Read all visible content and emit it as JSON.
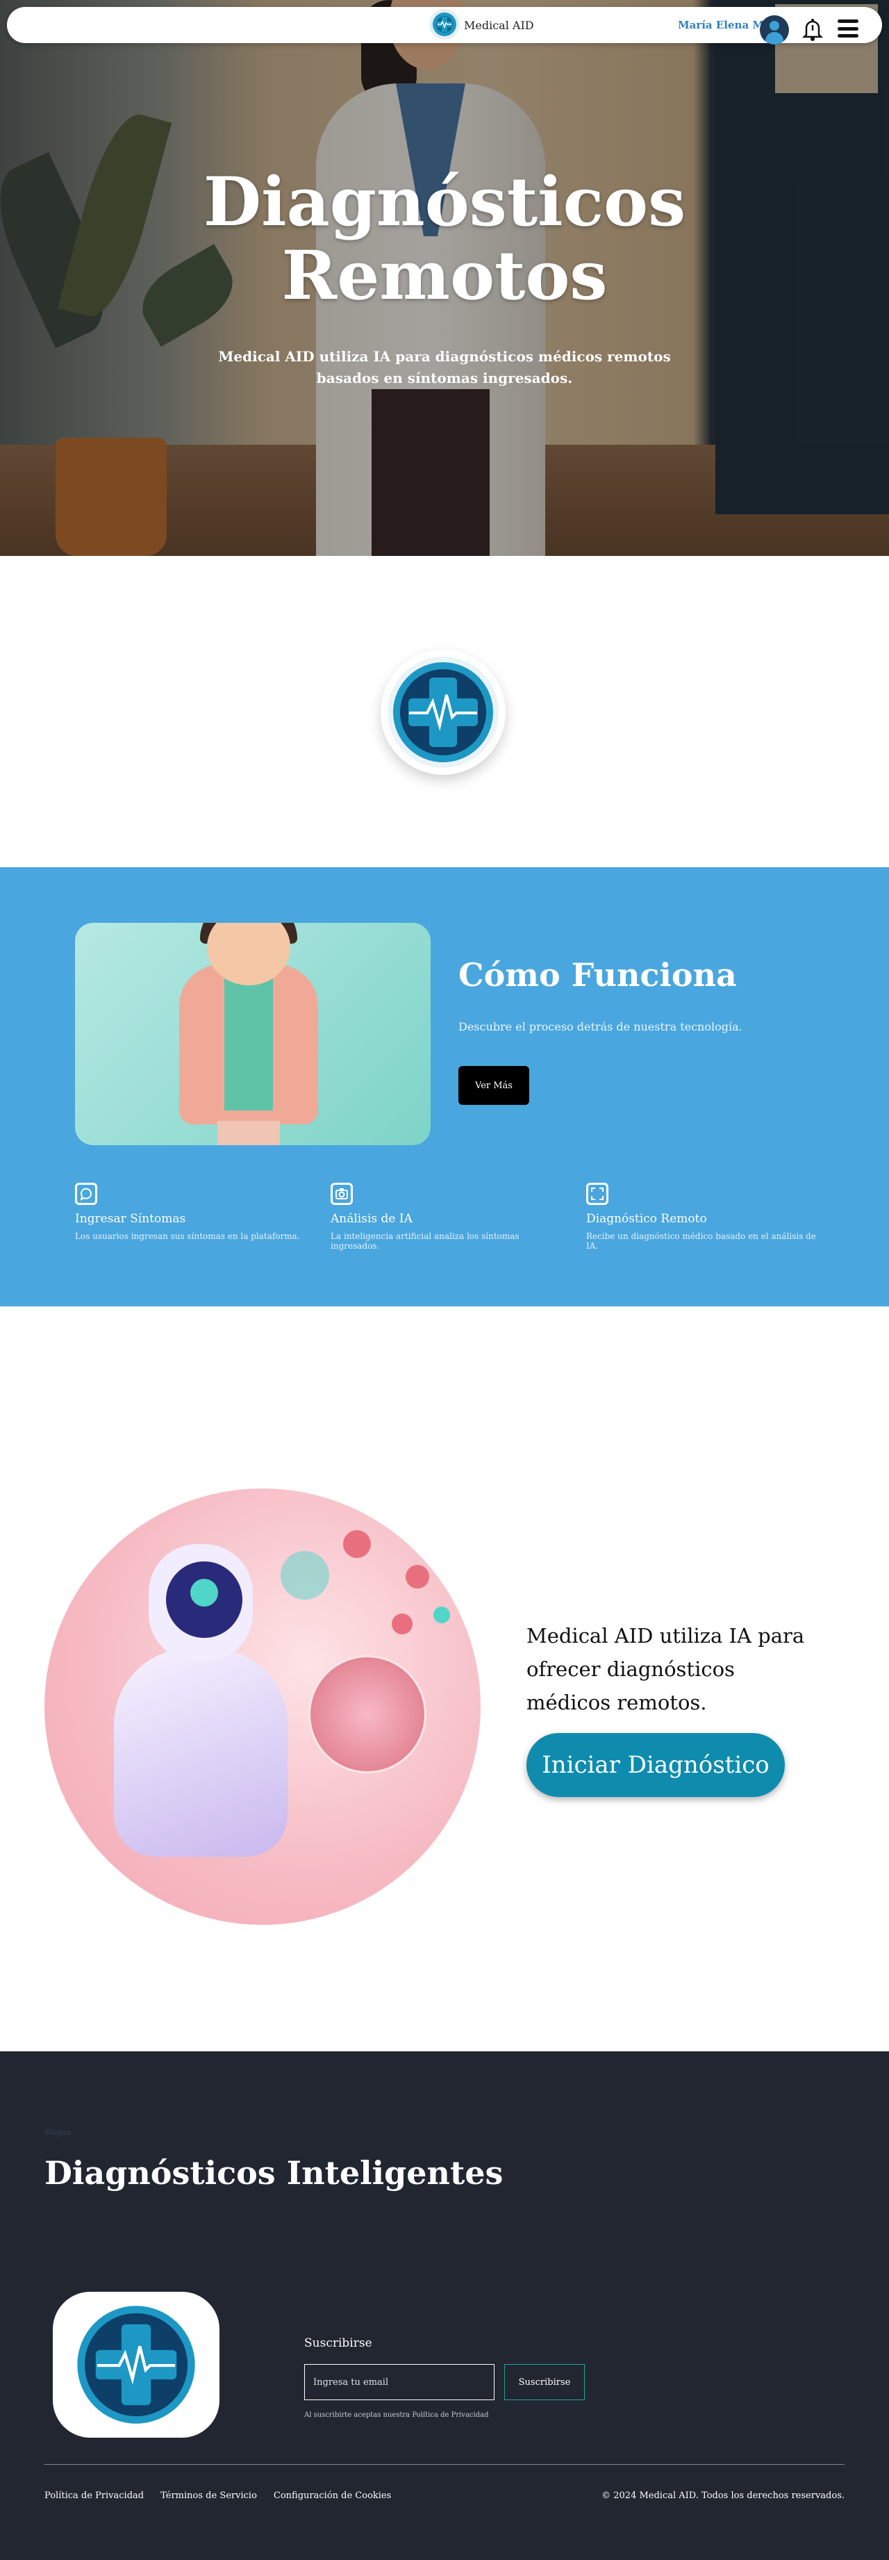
{
  "nav": {
    "brand": "Medical AID",
    "user_name": "María Elena M"
  },
  "hero": {
    "title_line1": "Diagnósticos",
    "title_line2": "Remotos",
    "subtitle": "Medical AID utiliza IA para diagnósticos médicos remotos basados en síntomas ingresados."
  },
  "how": {
    "title": "Cómo Funciona",
    "description": "Descubre el proceso detrás de nuestra tecnología.",
    "button": "Ver Más",
    "features": [
      {
        "icon": "chat-icon",
        "title": "Ingresar Síntomas",
        "text": "Los usuarios ingresan sus síntomas en la plataforma."
      },
      {
        "icon": "camera-icon",
        "title": "Análisis de IA",
        "text": "La inteligencia artificial analiza los síntomas ingresados."
      },
      {
        "icon": "expand-icon",
        "title": "Diagnóstico Remoto",
        "text": "Recibe un diagnóstico médico basado en el análisis de IA."
      }
    ]
  },
  "ai": {
    "text": "Medical AID utiliza IA para ofrecer diagnósticos médicos remotos.",
    "cta": "Iniciar Diagnóstico"
  },
  "footer": {
    "eyebrow": "Slogan",
    "title": "Diagnósticos Inteligentes",
    "subscribe_label": "Suscribirse",
    "email_placeholder": "Ingresa tu email",
    "subscribe_button": "Suscribirse",
    "fine_print": "Al suscribirte aceptas nuestra Política de Privacidad",
    "links": [
      "Política de Privacidad",
      "Términos de Servicio",
      "Configuración de Cookies"
    ],
    "copyright": "© 2024 Medical AID. Todos los derechos reservados."
  },
  "colors": {
    "primary_blue": "#4aa6de",
    "cta_teal": "#0f8cad",
    "footer_bg": "#212631",
    "user_name_blue": "#2f7fc0"
  }
}
